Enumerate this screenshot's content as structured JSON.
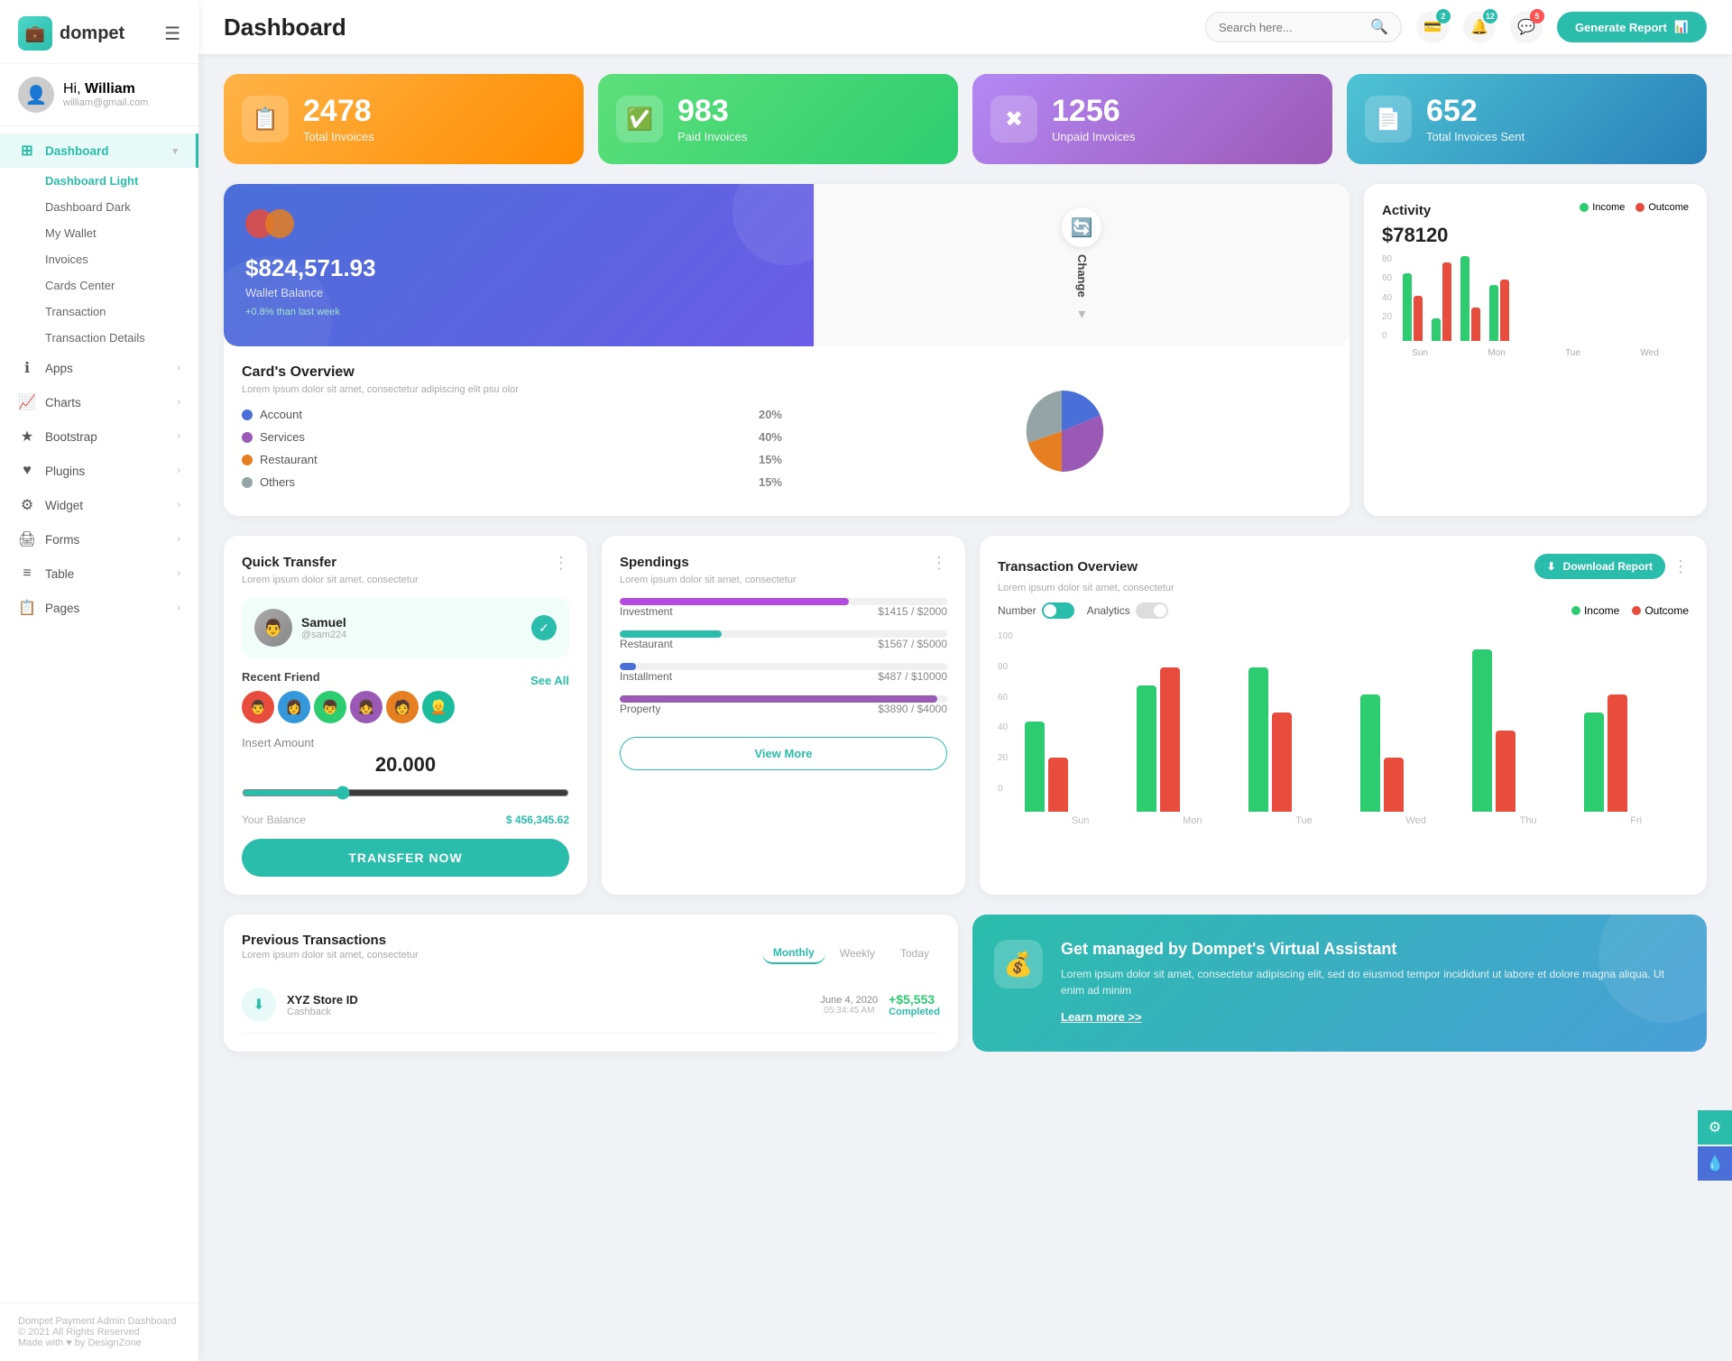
{
  "sidebar": {
    "logo": "dompet",
    "logo_icon": "💼",
    "user": {
      "greeting": "Hi,",
      "name": "William",
      "email": "william@gmail.com",
      "avatar": "👤"
    },
    "nav": [
      {
        "id": "dashboard",
        "label": "Dashboard",
        "icon": "⊞",
        "active": true,
        "expanded": true,
        "children": [
          {
            "id": "dashboard-light",
            "label": "Dashboard Light",
            "active": true
          },
          {
            "id": "dashboard-dark",
            "label": "Dashboard Dark",
            "active": false
          },
          {
            "id": "my-wallet",
            "label": "My Wallet",
            "active": false
          },
          {
            "id": "invoices",
            "label": "Invoices",
            "active": false
          },
          {
            "id": "cards-center",
            "label": "Cards Center",
            "active": false
          },
          {
            "id": "transaction",
            "label": "Transaction",
            "active": false
          },
          {
            "id": "transaction-details",
            "label": "Transaction Details",
            "active": false
          }
        ]
      },
      {
        "id": "apps",
        "label": "Apps",
        "icon": "ℹ",
        "active": false,
        "arrow": "›"
      },
      {
        "id": "charts",
        "label": "Charts",
        "icon": "📈",
        "active": false,
        "arrow": "›"
      },
      {
        "id": "bootstrap",
        "label": "Bootstrap",
        "icon": "★",
        "active": false,
        "arrow": "›"
      },
      {
        "id": "plugins",
        "label": "Plugins",
        "icon": "♥",
        "active": false,
        "arrow": "›"
      },
      {
        "id": "widget",
        "label": "Widget",
        "icon": "⚙",
        "active": false,
        "arrow": "›"
      },
      {
        "id": "forms",
        "label": "Forms",
        "icon": "🖨",
        "active": false,
        "arrow": "›"
      },
      {
        "id": "table",
        "label": "Table",
        "icon": "≡",
        "active": false,
        "arrow": "›"
      },
      {
        "id": "pages",
        "label": "Pages",
        "icon": "📋",
        "active": false,
        "arrow": "›"
      }
    ],
    "footer_line1": "Dompet Payment Admin Dashboard",
    "footer_line2": "© 2021 All Rights Reserved",
    "footer_line3": "Made with ♥ by DesignZone"
  },
  "topbar": {
    "title": "Dashboard",
    "search_placeholder": "Search here...",
    "badges": {
      "wallet": "2",
      "bell": "12",
      "chat": "5"
    },
    "generate_btn": "Generate Report"
  },
  "stat_cards": [
    {
      "id": "total-invoices",
      "number": "2478",
      "label": "Total Invoices",
      "color": "orange",
      "icon": "📋"
    },
    {
      "id": "paid-invoices",
      "number": "983",
      "label": "Paid Invoices",
      "color": "green",
      "icon": "✅"
    },
    {
      "id": "unpaid-invoices",
      "number": "1256",
      "label": "Unpaid Invoices",
      "color": "purple",
      "icon": "✖"
    },
    {
      "id": "total-sent",
      "number": "652",
      "label": "Total Invoices Sent",
      "color": "teal",
      "icon": "📄"
    }
  ],
  "wallet": {
    "amount": "$824,571.93",
    "label": "Wallet Balance",
    "change": "+0.8% than last week",
    "change_label": "Change"
  },
  "cards_overview": {
    "title": "Card's Overview",
    "desc": "Lorem ipsum dolor sit amet, consectetur adipiscing elit psu olor",
    "items": [
      {
        "label": "Account",
        "pct": "20%",
        "color": "blue"
      },
      {
        "label": "Services",
        "pct": "40%",
        "color": "purple"
      },
      {
        "label": "Restaurant",
        "pct": "15%",
        "color": "orange"
      },
      {
        "label": "Others",
        "pct": "15%",
        "color": "gray"
      }
    ],
    "pie_data": [
      {
        "label": "Account",
        "value": 20,
        "color": "#4a6fd8"
      },
      {
        "label": "Services",
        "value": 40,
        "color": "#9b59b6"
      },
      {
        "label": "Restaurant",
        "value": 15,
        "color": "#e67e22"
      },
      {
        "label": "Others",
        "value": 15,
        "color": "#95a5a6"
      }
    ]
  },
  "activity": {
    "title": "Activity",
    "amount": "$78120",
    "legend": {
      "income": "Income",
      "outcome": "Outcome"
    },
    "bars": [
      {
        "day": "Sun",
        "income": 60,
        "outcome": 40
      },
      {
        "day": "Mon",
        "income": 20,
        "outcome": 70
      },
      {
        "day": "Tue",
        "income": 75,
        "outcome": 30
      },
      {
        "day": "Wed",
        "income": 50,
        "outcome": 55
      }
    ]
  },
  "quick_transfer": {
    "title": "Quick Transfer",
    "desc": "Lorem ipsum dolor sit amet, consectetur",
    "contact": {
      "name": "Samuel",
      "handle": "@sam224",
      "avatar": "👨"
    },
    "recent_label": "Recent Friend",
    "see_all": "See All",
    "amount_label": "Insert Amount",
    "amount": "20.000",
    "balance_label": "Your Balance",
    "balance": "$ 456,345.62",
    "transfer_btn": "TRANSFER NOW"
  },
  "spendings": {
    "title": "Spendings",
    "desc": "Lorem ipsum dolor sit amet, consectetur",
    "items": [
      {
        "label": "Investment",
        "current": "$1415",
        "max": "$2000",
        "pct": 70,
        "color": "#b44ae0"
      },
      {
        "label": "Restaurant",
        "current": "$1567",
        "max": "$5000",
        "pct": 31,
        "color": "#2bbdab"
      },
      {
        "label": "Installment",
        "current": "$487",
        "max": "$10000",
        "pct": 5,
        "color": "#4a6fd8"
      },
      {
        "label": "Property",
        "current": "$3890",
        "max": "$4000",
        "pct": 97,
        "color": "#9b59b6"
      }
    ],
    "view_more_btn": "View More"
  },
  "transaction_overview": {
    "title": "Transaction Overview",
    "desc": "Lorem ipsum dolor sit amet, consectetur",
    "controls": {
      "number_label": "Number",
      "analytics_label": "Analytics"
    },
    "legend": {
      "income": "Income",
      "outcome": "Outcome"
    },
    "download_btn": "Download Report",
    "bars": [
      {
        "day": "Sun",
        "income": 50,
        "outcome": 30
      },
      {
        "day": "Mon",
        "income": 70,
        "outcome": 80
      },
      {
        "day": "Tue",
        "income": 80,
        "outcome": 55
      },
      {
        "day": "Wed",
        "income": 65,
        "outcome": 30
      },
      {
        "day": "Thu",
        "income": 90,
        "outcome": 45
      },
      {
        "day": "Fri",
        "income": 55,
        "outcome": 65
      }
    ],
    "y_labels": [
      "100",
      "80",
      "60",
      "40",
      "20",
      "0"
    ]
  },
  "previous_transactions": {
    "title": "Previous Transactions",
    "desc": "Lorem ipsum dolor sit amet, consectetur",
    "tabs": [
      "Monthly",
      "Weekly",
      "Today"
    ],
    "active_tab": "Monthly",
    "items": [
      {
        "icon": "⬇",
        "name": "XYZ Store ID",
        "sub": "Cashback",
        "date": "June 4, 2020",
        "time": "05:34:45 AM",
        "amount": "+$5,553",
        "status": "Completed"
      }
    ]
  },
  "virtual_assistant": {
    "title": "Get managed by Dompet's Virtual Assistant",
    "desc": "Lorem ipsum dolor sit amet, consectetur adipiscing elit, sed do eiusmod tempor incididunt ut labore et dolore magna aliqua. Ut enim ad minim",
    "link": "Learn more >>",
    "icon": "💰"
  }
}
